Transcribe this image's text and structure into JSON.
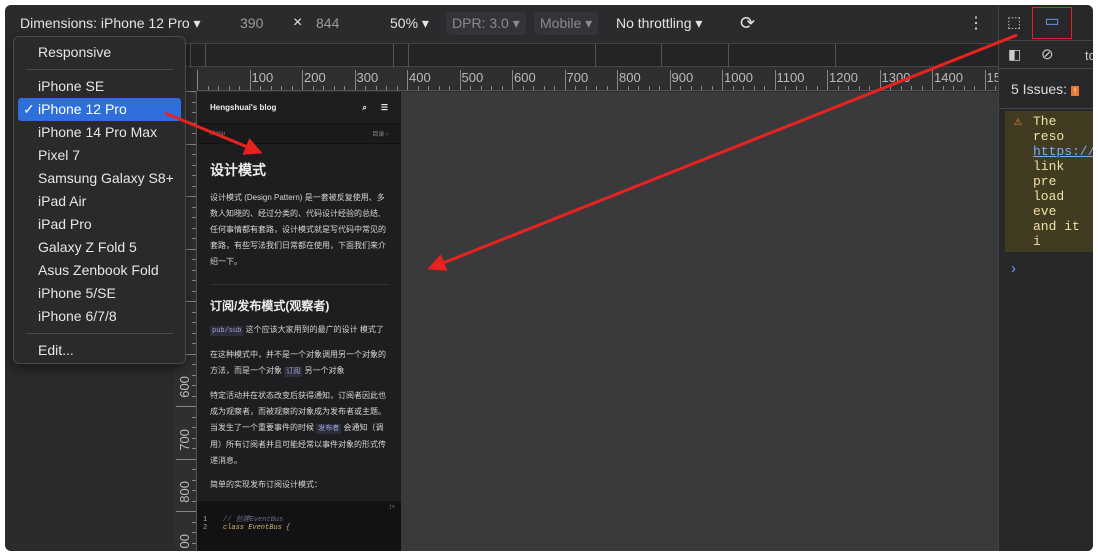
{
  "toolbar": {
    "dimensions": "Dimensions: iPhone 12 Pro",
    "width": "390",
    "times": "×",
    "height": "844",
    "zoom": "50%",
    "dpr": "DPR: 3.0",
    "mobile": "Mobile",
    "throttling": "No throttling"
  },
  "menu": {
    "items": [
      "Responsive",
      "iPhone SE",
      "iPhone 12 Pro",
      "iPhone 14 Pro Max",
      "Pixel 7",
      "Samsung Galaxy S8+",
      "iPad Air",
      "iPad Pro",
      "Galaxy Z Fold 5",
      "Asus Zenbook Fold",
      "iPhone 5/SE",
      "iPhone 6/7/8",
      "Edit..."
    ],
    "selected": "iPhone 12 Pro",
    "check": "✓"
  },
  "ruler": {
    "h": [
      "100",
      "200",
      "300",
      "400",
      "500",
      "600",
      "700",
      "800",
      "900",
      "1000",
      "1100",
      "1200",
      "1300",
      "1400",
      "15"
    ],
    "v": [
      "600",
      "700",
      "800",
      "00"
    ]
  },
  "blog": {
    "title": "Hengshuai's blog",
    "menu": "Menu",
    "toc": "目录 ›",
    "h1": "设计模式",
    "intro": "设计模式 (Design Pattern) 是一套被反复使用、多数人知晓的、经过分类的、代码设计经验的总结,任何事情都有套路，设计模式就是写代码中常见的套路，有些写法我们日常都在使用，下面我们来介绍一下。",
    "h2": "订阅/发布模式(观察者)",
    "p1_code": "pub/sub",
    "p1": "这个应该大家用到的最广的设计 模式了",
    "p2a": "在这种模式中，并不是一个对象调用另一个对象的方法，而是一个对象",
    "p2_code": "订阅",
    "p2b": "另一个对象",
    "p3a": "特定活动并在状态改变后获得通知，订阅者因此也成为观察者，而被观察的对象成为发布者或主题。当发生了一个重要事件的时候",
    "p3_code": "发布者",
    "p3b": "会通知（调用）所有订阅者并且可能经常以事件对象的形式传递消息。",
    "p4": "简单的实现发布订阅设计模式：",
    "code_lang": "js",
    "code_lines": [
      {
        "n": "1",
        "t": "// 创建EventBus"
      },
      {
        "n": "2",
        "t": "class EventBus {"
      }
    ]
  },
  "devtools": {
    "tab": "to",
    "issues": "5 Issues:",
    "console": [
      "The reso",
      "https://",
      "link pre",
      "load eve",
      "and it i"
    ],
    "prompt": "›"
  },
  "colors": {
    "accent": "#2f6fdb",
    "annotation": "#e8231f"
  }
}
